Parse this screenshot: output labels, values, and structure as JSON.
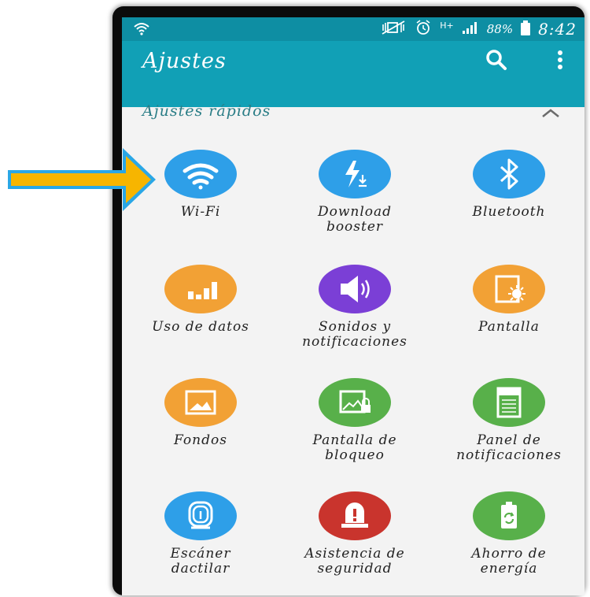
{
  "status_bar": {
    "battery": "88%",
    "time": "8:42",
    "network": "H+"
  },
  "app_bar": {
    "title": "Ajustes"
  },
  "section": {
    "title": "Ajustes rápidos"
  },
  "colors": {
    "blue": "#2e9fe8",
    "orange": "#f2a135",
    "purple": "#7b3fd6",
    "green": "#58b04a",
    "red": "#c9342d",
    "header": "#11a0b6"
  },
  "tiles": [
    {
      "label": "Wi-Fi",
      "icon": "wifi-icon",
      "color": "blue"
    },
    {
      "label": "Download\nbooster",
      "icon": "download-booster-icon",
      "color": "blue"
    },
    {
      "label": "Bluetooth",
      "icon": "bluetooth-icon",
      "color": "blue"
    },
    {
      "label": "Uso de datos",
      "icon": "data-usage-icon",
      "color": "orange"
    },
    {
      "label": "Sonidos y\nnotificaciones",
      "icon": "speaker-icon",
      "color": "purple"
    },
    {
      "label": "Pantalla",
      "icon": "display-icon",
      "color": "orange"
    },
    {
      "label": "Fondos",
      "icon": "wallpaper-icon",
      "color": "orange"
    },
    {
      "label": "Pantalla de\nbloqueo",
      "icon": "lock-screen-icon",
      "color": "green"
    },
    {
      "label": "Panel de\nnotificaciones",
      "icon": "notification-panel-icon",
      "color": "green"
    },
    {
      "label": "Escáner\ndactilar",
      "icon": "fingerprint-icon",
      "color": "blue"
    },
    {
      "label": "Asistencia de\nseguridad",
      "icon": "emergency-icon",
      "color": "red"
    },
    {
      "label": "Ahorro de\nenergía",
      "icon": "battery-saver-icon",
      "color": "green"
    }
  ]
}
